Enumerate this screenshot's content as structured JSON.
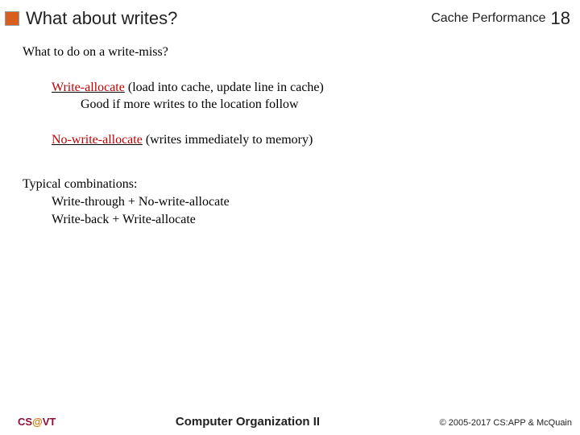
{
  "header": {
    "title": "What about writes?",
    "topic": "Cache Performance",
    "page": "18"
  },
  "body": {
    "question": "What to do on a write-miss?",
    "policy1": {
      "name": "Write-allocate",
      "desc": " (load into cache, update line in cache)",
      "note": "Good if more writes to the location follow"
    },
    "policy2": {
      "name": "No-write-allocate",
      "desc": " (writes immediately to memory)"
    },
    "combos": {
      "heading": "Typical combinations:",
      "item1": "Write-through + No-write-allocate",
      "item2": "Write-back + Write-allocate"
    }
  },
  "footer": {
    "cs": "CS",
    "at": "@",
    "vt": "VT",
    "center": "Computer Organization II",
    "right": "© 2005-2017 CS:APP & McQuain"
  }
}
